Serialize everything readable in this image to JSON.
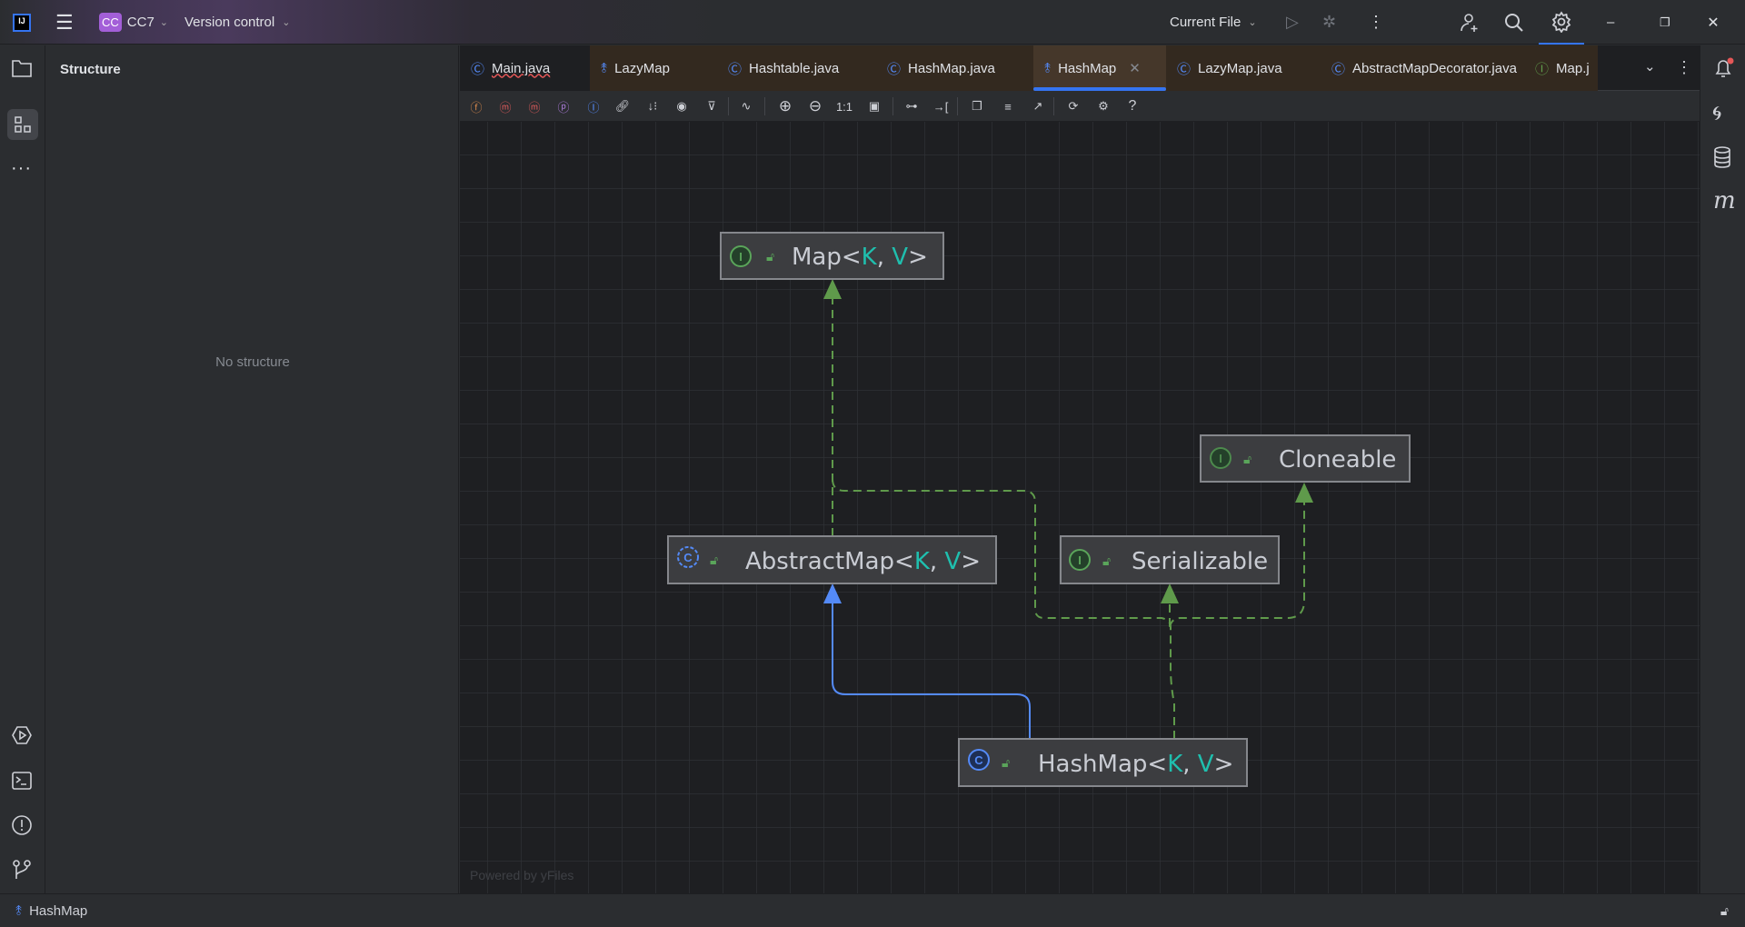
{
  "titlebar": {
    "project_badge": "CC",
    "project_name": "CC7",
    "vcs": "Version control",
    "run_config": "Current File"
  },
  "structure": {
    "title": "Structure",
    "empty_text": "No structure"
  },
  "tabs": [
    {
      "label": "Main.java",
      "icon": "class-icon",
      "active": false
    },
    {
      "label": "LazyMap",
      "icon": "diagram-icon",
      "active": false
    },
    {
      "label": "Hashtable.java",
      "icon": "class-icon",
      "active": false
    },
    {
      "label": "HashMap.java",
      "icon": "class-icon",
      "active": false
    },
    {
      "label": "HashMap",
      "icon": "diagram-icon",
      "active": true
    },
    {
      "label": "LazyMap.java",
      "icon": "class-icon",
      "active": false
    },
    {
      "label": "AbstractMapDecorator.java",
      "icon": "class-icon",
      "active": false
    },
    {
      "label": "Map.j",
      "icon": "interface-icon",
      "active": false
    }
  ],
  "toolbar": {
    "actual_size": "1:1",
    "help": "?"
  },
  "diagram": {
    "nodes": {
      "map": {
        "name": "Map",
        "kind": "interface",
        "generics": [
          "K",
          "V"
        ]
      },
      "cloneable": {
        "name": "Cloneable",
        "kind": "interface"
      },
      "abstractmap": {
        "name": "AbstractMap",
        "kind": "abstract-class",
        "generics": [
          "K",
          "V"
        ]
      },
      "serializable": {
        "name": "Serializable",
        "kind": "interface"
      },
      "hashmap": {
        "name": "HashMap",
        "kind": "class",
        "generics": [
          "K",
          "V"
        ]
      }
    },
    "sep_open": "<",
    "sep_comma": ", ",
    "sep_close": ">",
    "watermark": "Powered by yFiles",
    "colors": {
      "implements": "#5f9a4b",
      "extends": "#548af7",
      "generic": "#1fbfae"
    }
  },
  "statusbar": {
    "label": "HashMap"
  }
}
